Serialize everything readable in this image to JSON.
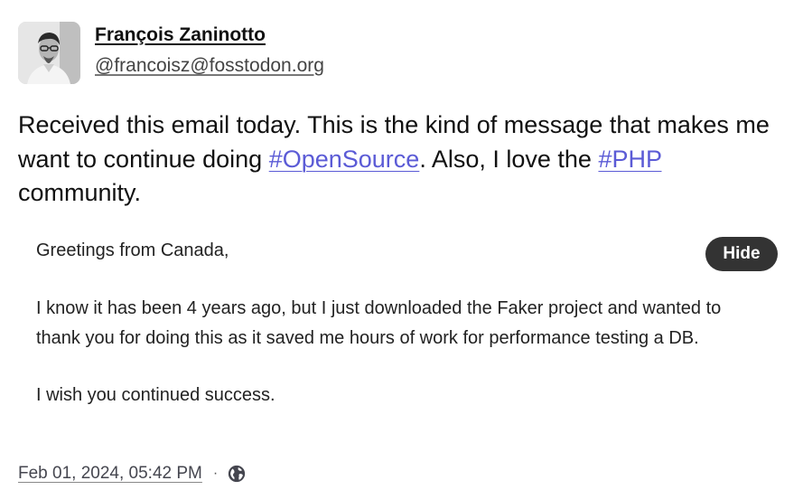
{
  "author": {
    "display_name": "François Zaninotto",
    "handle": "@francoisz@fosstodon.org"
  },
  "post": {
    "text_part1": "Received this email today. This is the kind of message that makes me want to continue doing ",
    "hashtag1": "#OpenSource",
    "text_part2": ". Also, I love the ",
    "hashtag2": "#PHP",
    "text_part3": " community."
  },
  "email": {
    "greeting": "Greetings from Canada,",
    "line1": "I know it has been 4 years ago, but I just downloaded the Faker project and wanted to",
    "line2": "thank you for doing this as it saved me hours of work for performance testing a DB.",
    "line3": "I wish you continued success."
  },
  "media": {
    "hide_label": "Hide"
  },
  "footer": {
    "timestamp": "Feb 01, 2024, 05:42 PM",
    "separator": "·",
    "visibility_icon": "globe-icon"
  },
  "colors": {
    "hashtag": "#5b5bd6",
    "hide_button_bg": "#333333"
  }
}
